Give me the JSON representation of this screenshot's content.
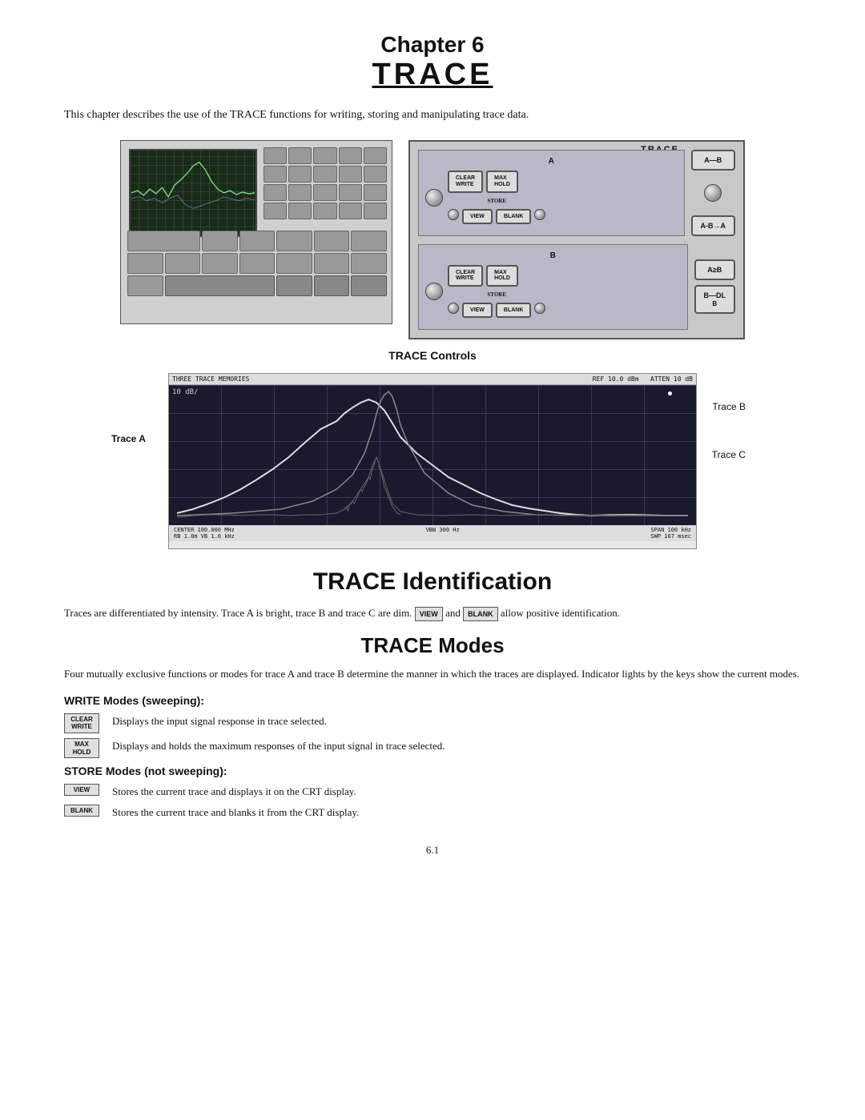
{
  "header": {
    "chapter": "Chapter 6",
    "title": "TRACE"
  },
  "intro": {
    "text": "This chapter describes the use of the TRACE functions for writing, storing and manipulating trace data."
  },
  "trace_controls_label": "TRACE Controls",
  "trace_panel": {
    "label": "TRACE",
    "section_a_label": "A",
    "section_b_label": "B",
    "buttons": {
      "clear_write": "CLEAR\nWRITE",
      "max_hold": "MAX\nHOLD",
      "store": "STORE",
      "view": "VIEW",
      "blank": "BLANK",
      "a_minus_b": "A—B",
      "a_minus_b_arrow": "A-B→A",
      "b_minus_dl": "B—DL\nB"
    }
  },
  "spectrum": {
    "header_left": "THREE TRACE MEMORIES",
    "header_ref": "REF  10.0 dBm   ATTEN 10 dB",
    "y_label": "10 dB/",
    "footer_center": "CENTER  100.000 MHz",
    "footer_left": "RB 1.0m  VB 1.0 kHz",
    "footer_mid": "VBW 300 Hz",
    "footer_right": "SPAN 100 kHz\nSWP 167 msec",
    "trace_a": "Trace A",
    "trace_b": "Trace B",
    "trace_c": "Trace C"
  },
  "trace_identification": {
    "heading": "TRACE Identification",
    "text": "Traces are differentiated by intensity. Trace A is bright, trace B and trace C are dim.",
    "text2": "and",
    "text3": "allow positive identification.",
    "view_btn": "VIEW",
    "blank_btn": "BLANK"
  },
  "trace_modes": {
    "heading": "TRACE Modes",
    "intro": "Four mutually exclusive functions or modes for trace A and trace B determine the manner in which the traces are displayed. Indicator lights by the keys show the current modes.",
    "write_modes_heading": "WRITE Modes (sweeping):",
    "write_modes": [
      {
        "btn": "CLEAR\nWRITE",
        "desc": "Displays the input signal response in trace selected."
      },
      {
        "btn": "MAX\nHOLD",
        "desc": "Displays and holds the maximum responses of the input signal in trace selected."
      }
    ],
    "store_modes_heading": "STORE Modes (not sweeping):",
    "store_modes": [
      {
        "btn": "VIEW",
        "desc": "Stores the current trace and displays it on the CRT display."
      },
      {
        "btn": "BLANK",
        "desc": "Stores the current trace and blanks it from the CRT display."
      }
    ]
  },
  "page_number": "6.1"
}
